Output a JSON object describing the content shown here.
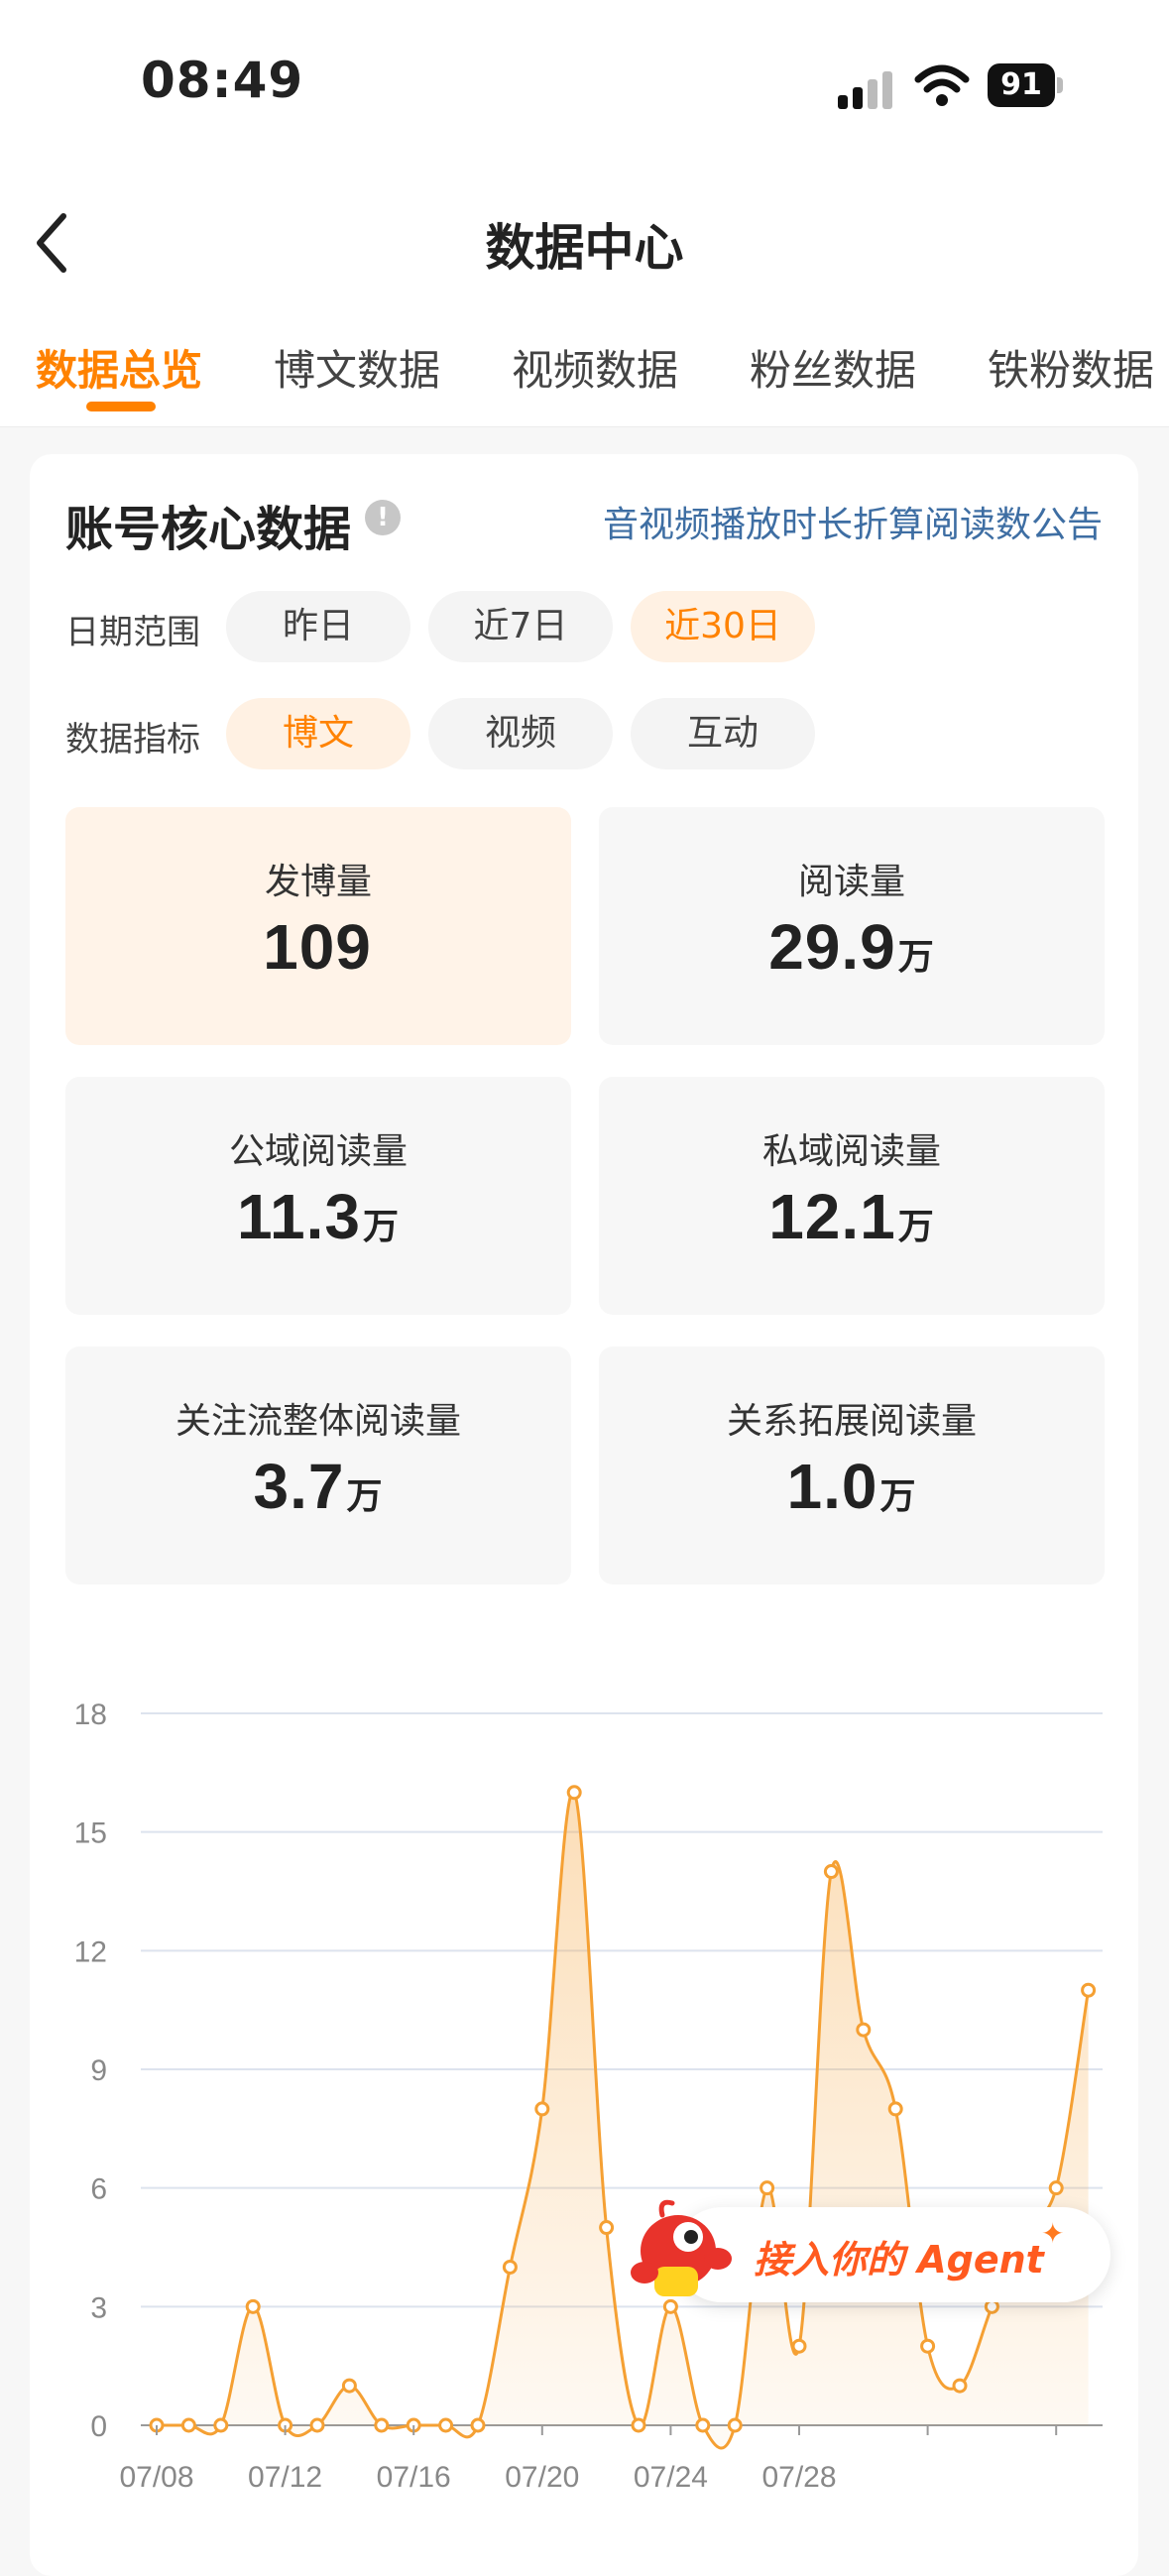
{
  "status_bar": {
    "time": "08:49",
    "battery": "91"
  },
  "nav": {
    "title": "数据中心"
  },
  "tabs": [
    {
      "label": "数据总览",
      "active": true
    },
    {
      "label": "博文数据",
      "active": false
    },
    {
      "label": "视频数据",
      "active": false
    },
    {
      "label": "粉丝数据",
      "active": false
    },
    {
      "label": "铁粉数据",
      "active": false
    }
  ],
  "core": {
    "title": "账号核心数据",
    "info_glyph": "!",
    "notice_link": "音视频播放时长折算阅读数公告",
    "date_range": {
      "label": "日期范围",
      "options": [
        "昨日",
        "近7日",
        "近30日"
      ],
      "selected": "近30日"
    },
    "metric": {
      "label": "数据指标",
      "options": [
        "博文",
        "视频",
        "互动"
      ],
      "selected": "博文"
    },
    "stats": [
      {
        "label": "发博量",
        "value": "109",
        "unit": "",
        "active": true
      },
      {
        "label": "阅读量",
        "value": "29.9",
        "unit": "万",
        "active": false
      },
      {
        "label": "公域阅读量",
        "value": "11.3",
        "unit": "万",
        "active": false
      },
      {
        "label": "私域阅读量",
        "value": "12.1",
        "unit": "万",
        "active": false
      },
      {
        "label": "关注流整体阅读量",
        "value": "3.7",
        "unit": "万",
        "active": false
      },
      {
        "label": "关系拓展阅读量",
        "value": "1.0",
        "unit": "万",
        "active": false
      }
    ]
  },
  "chart_data": {
    "type": "area",
    "color": "#f5a033",
    "ylim": [
      0,
      18
    ],
    "yticks": [
      0,
      3,
      6,
      9,
      12,
      15,
      18
    ],
    "x": [
      "07/08",
      "07/09",
      "07/10",
      "07/11",
      "07/12",
      "07/13",
      "07/14",
      "07/15",
      "07/16",
      "07/17",
      "07/18",
      "07/19",
      "07/20",
      "07/21",
      "07/22",
      "07/23",
      "07/24",
      "07/25",
      "07/26",
      "07/27",
      "07/28",
      "07/29",
      "07/30",
      "07/31",
      "08/01",
      "08/02",
      "08/03",
      "08/04",
      "08/05",
      "08/06",
      "08/07"
    ],
    "xtick_labels": [
      "07/08",
      "07/12",
      "07/16",
      "07/20",
      "07/24",
      "07/28"
    ],
    "values": [
      0,
      0,
      0,
      3,
      0,
      0,
      1,
      0,
      0,
      0,
      0,
      4,
      8,
      16,
      5,
      0,
      3,
      0,
      0,
      6,
      2,
      14,
      10,
      8,
      2,
      1,
      3,
      5,
      6,
      11
    ],
    "grid": true
  },
  "agent_banner": {
    "text": "接入你的 Agent",
    "spark": "✦"
  }
}
